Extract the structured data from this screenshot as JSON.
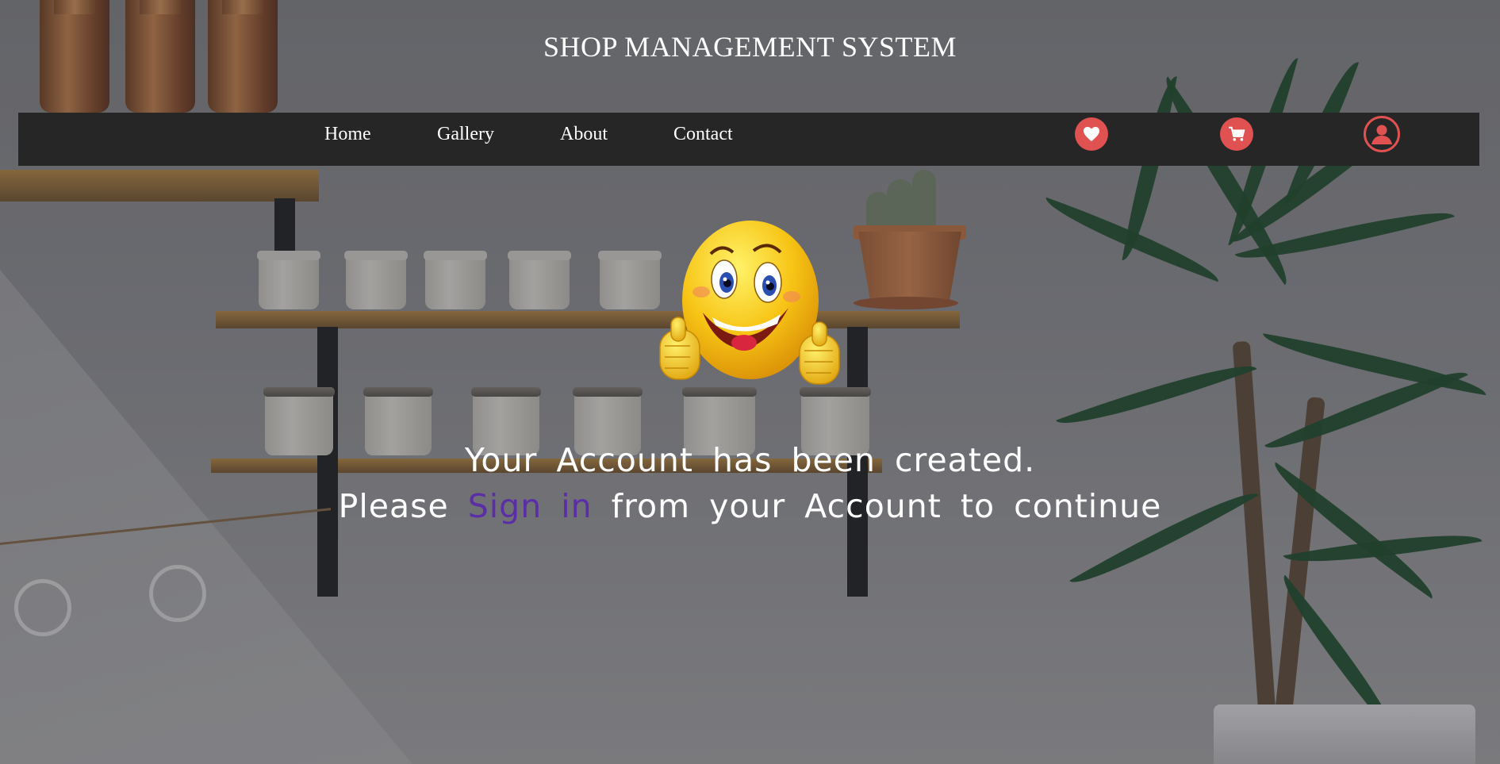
{
  "header": {
    "title": "SHOP MANAGEMENT SYSTEM"
  },
  "nav": {
    "links": [
      {
        "label": "Home"
      },
      {
        "label": "Gallery"
      },
      {
        "label": "About"
      },
      {
        "label": "Contact"
      }
    ],
    "icons": [
      "heart-icon",
      "cart-icon",
      "user-icon"
    ]
  },
  "main": {
    "line1": "Your Account has been created.",
    "line2_prefix": "Please",
    "line2_link": "Sign in",
    "line2_suffix": "from your Account to continue"
  },
  "colors": {
    "navbar": "#262626",
    "icon_accent": "#e05252",
    "link": "#5b2ea6",
    "text": "#ffffff"
  }
}
